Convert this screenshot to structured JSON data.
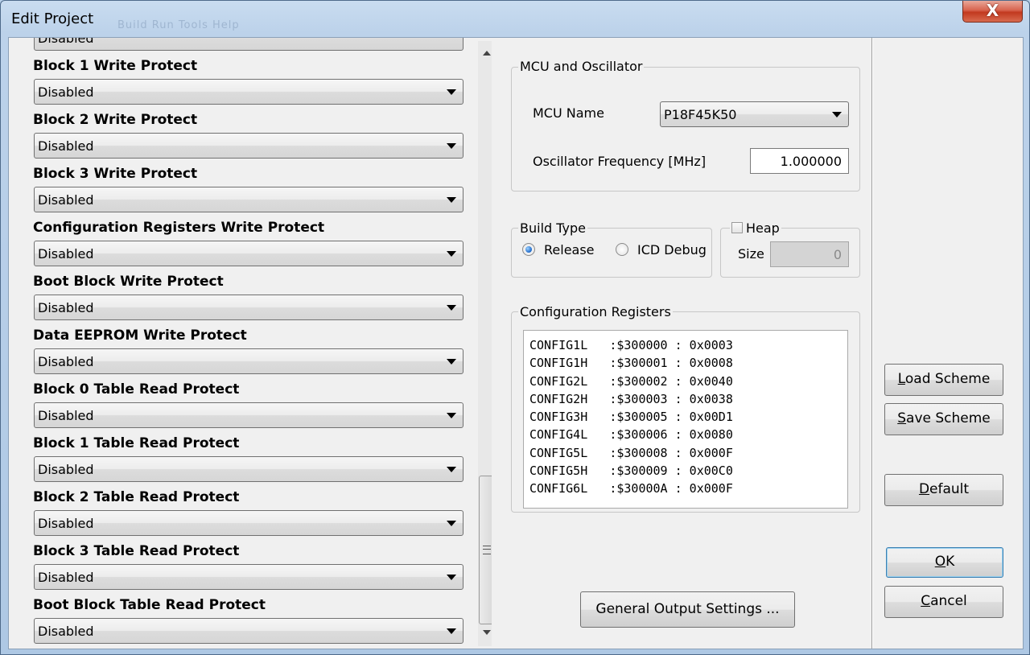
{
  "window": {
    "title": "Edit Project",
    "ghost_menu": "Build   Run   Tools   Help",
    "close_label": "X"
  },
  "config_list": {
    "top_partial_value": "Disabled",
    "items": [
      {
        "label": "Block 1 Write Protect",
        "value": "Disabled"
      },
      {
        "label": "Block 2 Write Protect",
        "value": "Disabled"
      },
      {
        "label": "Block 3 Write Protect",
        "value": "Disabled"
      },
      {
        "label": "Configuration Registers Write Protect",
        "value": "Disabled"
      },
      {
        "label": "Boot Block Write Protect",
        "value": "Disabled"
      },
      {
        "label": "Data EEPROM Write Protect",
        "value": "Disabled"
      },
      {
        "label": "Block 0 Table Read Protect",
        "value": "Disabled"
      },
      {
        "label": "Block 1 Table Read Protect",
        "value": "Disabled"
      },
      {
        "label": "Block 2 Table Read Protect",
        "value": "Disabled"
      },
      {
        "label": "Block 3 Table Read Protect",
        "value": "Disabled"
      },
      {
        "label": "Boot Block Table Read Protect",
        "value": "Disabled"
      }
    ]
  },
  "mcu": {
    "group_title": "MCU and Oscillator",
    "mcu_name_label": "MCU Name",
    "mcu_name_value": "P18F45K50",
    "osc_label": "Oscillator Frequency [MHz]",
    "osc_value": "1.000000"
  },
  "build_type": {
    "group_title": "Build Type",
    "release_label": "Release",
    "icd_label": "ICD Debug",
    "selected": "Release"
  },
  "heap": {
    "group_title": "Heap",
    "size_label": "Size",
    "size_value": "0",
    "enabled": false
  },
  "config_registers": {
    "group_title": "Configuration Registers",
    "lines": [
      "CONFIG1L   :$300000 : 0x0003",
      "CONFIG1H   :$300001 : 0x0008",
      "CONFIG2L   :$300002 : 0x0040",
      "CONFIG2H   :$300003 : 0x0038",
      "CONFIG3H   :$300005 : 0x00D1",
      "CONFIG4L   :$300006 : 0x0080",
      "CONFIG5L   :$300008 : 0x000F",
      "CONFIG5H   :$300009 : 0x00C0",
      "CONFIG6L   :$30000A : 0x000F"
    ]
  },
  "buttons": {
    "general_output": "General Output Settings ...",
    "load_scheme": {
      "first": "L",
      "rest": "oad Scheme"
    },
    "save_scheme": {
      "first": "S",
      "rest": "ave Scheme"
    },
    "default": {
      "first": "D",
      "rest": "efault"
    },
    "ok": {
      "first": "O",
      "rest": "K"
    },
    "cancel": {
      "first": "C",
      "rest": "ancel"
    }
  }
}
